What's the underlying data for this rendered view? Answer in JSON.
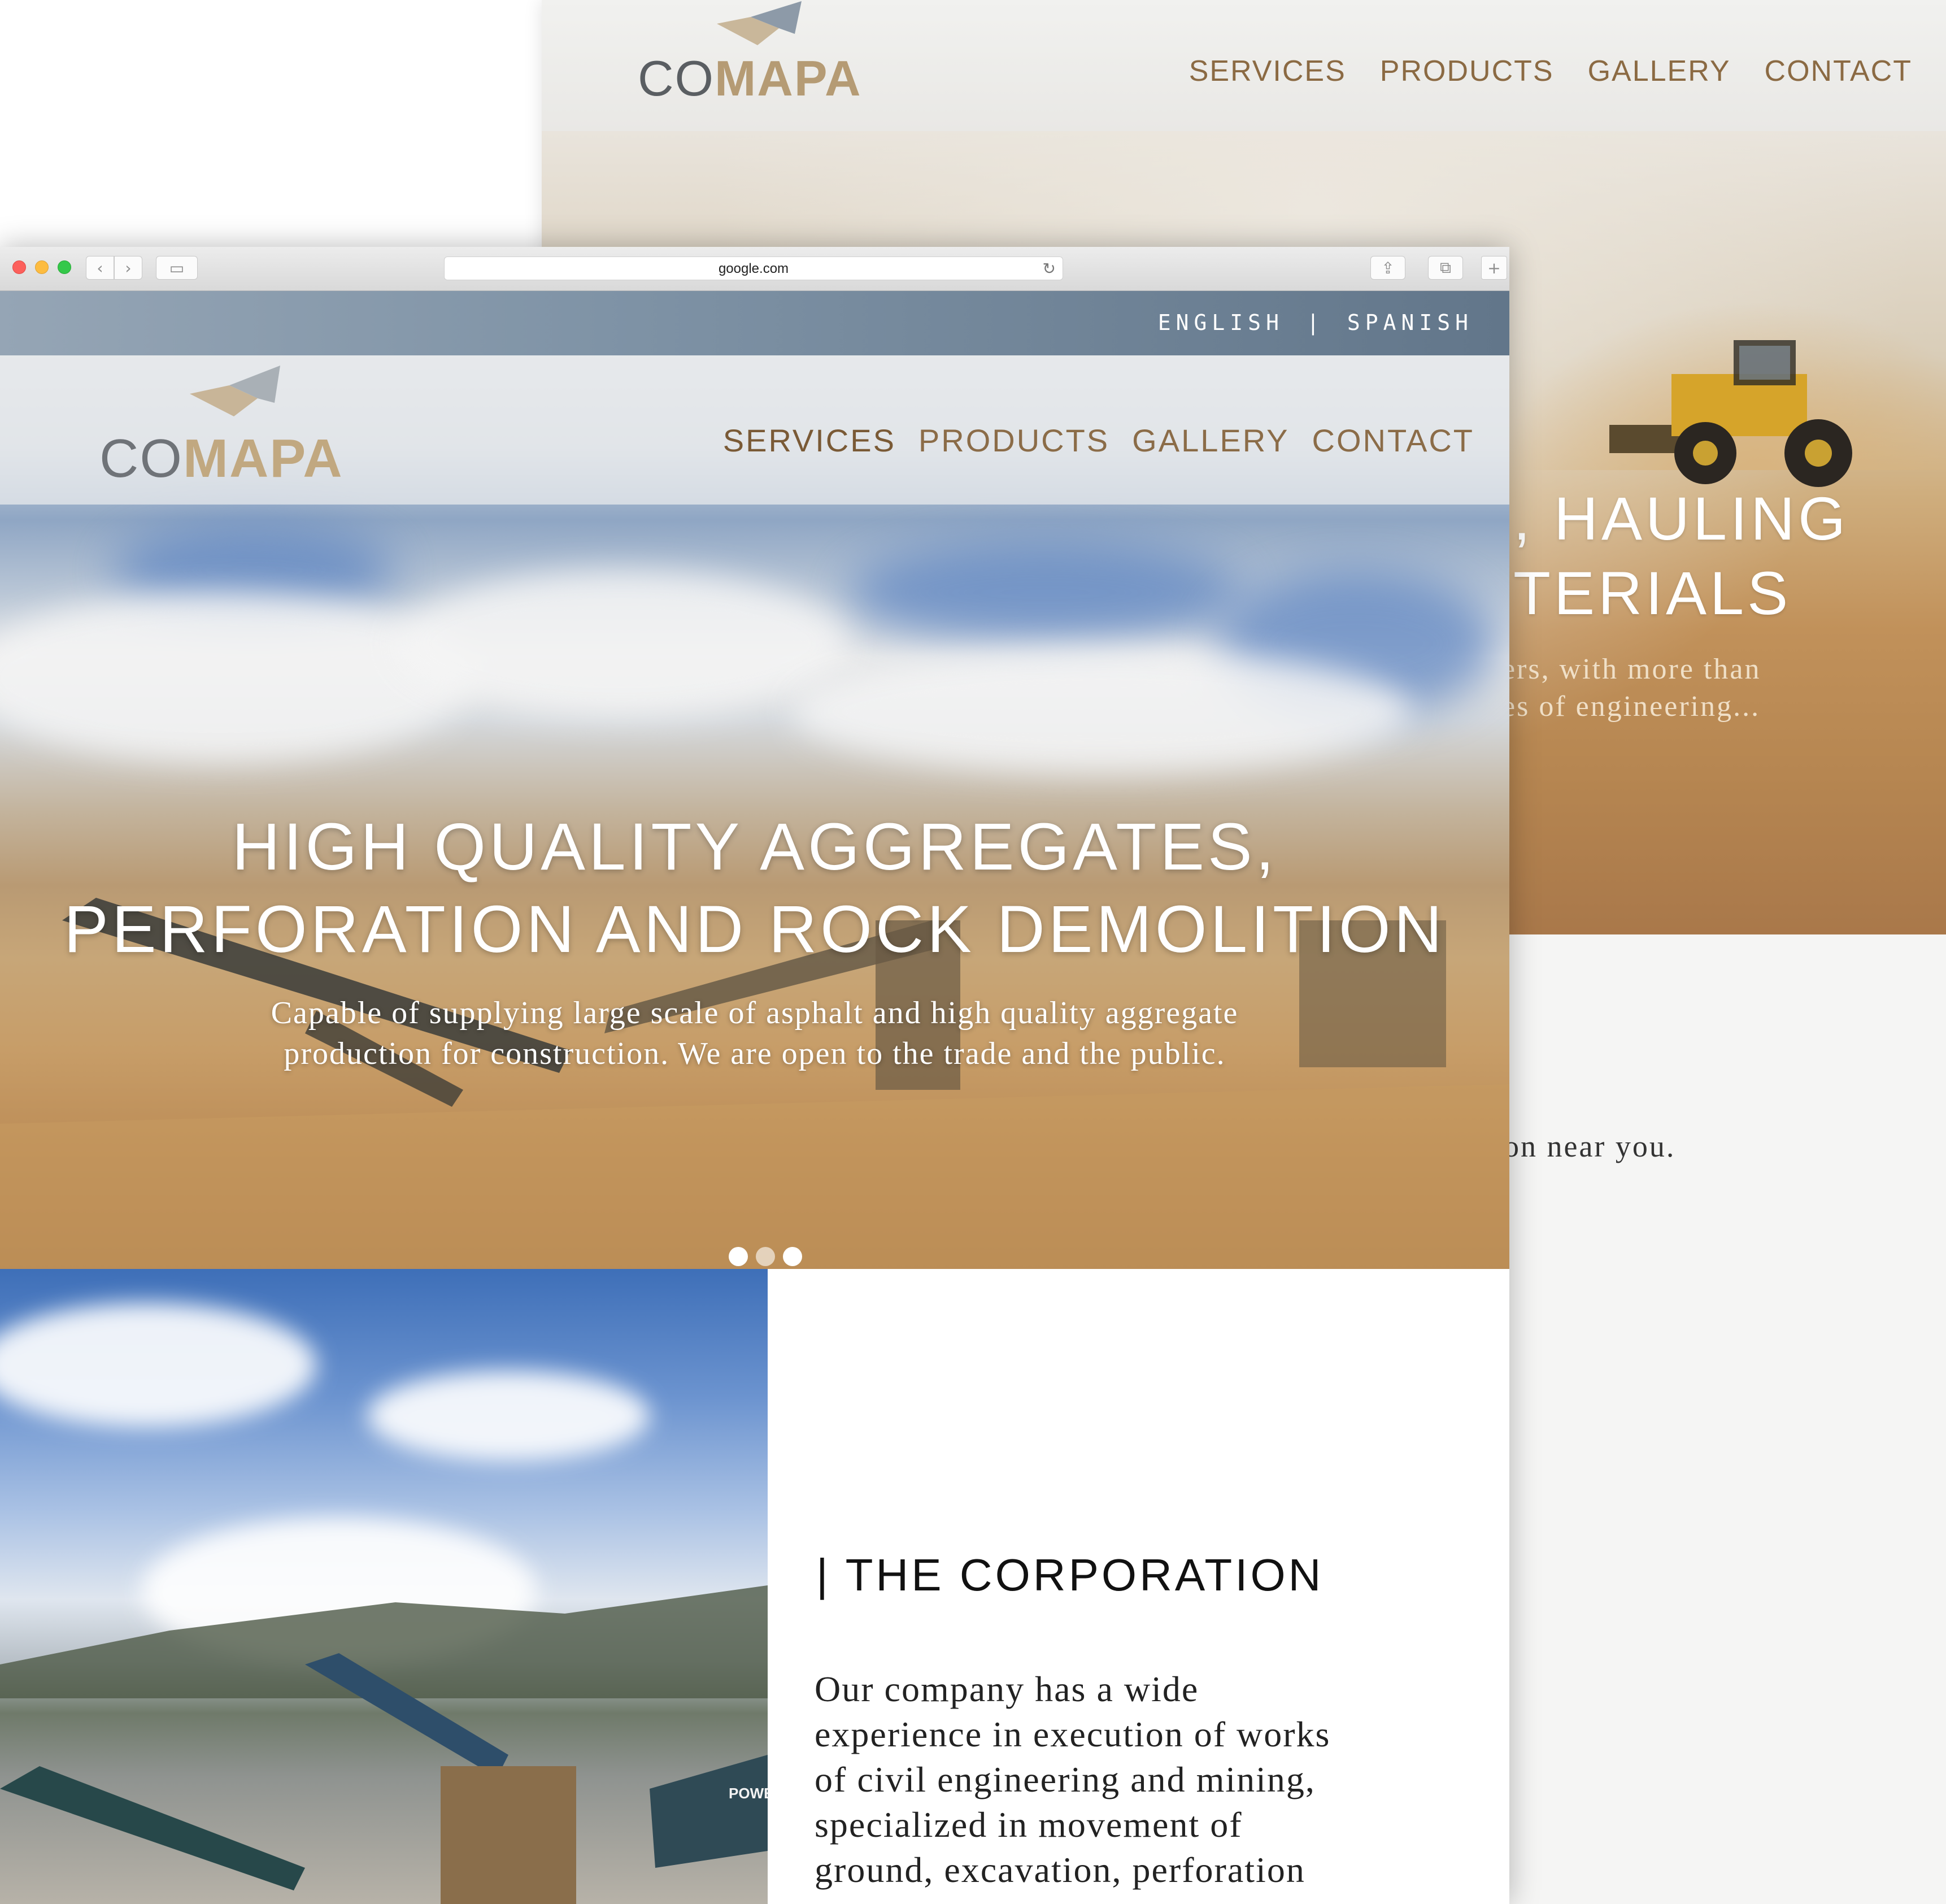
{
  "back_page": {
    "logo": {
      "part1": "CO",
      "part2": "MAPA"
    },
    "nav": [
      "SERVICES",
      "PRODUCTS",
      "GALLERY",
      "CONTACT"
    ],
    "hero_title": ", HAULING\nTERIALS",
    "hero_subtitle": "ers, with more than\nes of engineering...",
    "section_text": "ation near you."
  },
  "browser": {
    "address": "google.com"
  },
  "language": {
    "english": "ENGLISH",
    "separator": "|",
    "spanish": "SPANISH"
  },
  "logo": {
    "part1": "CO",
    "part2": "MAPA"
  },
  "nav": {
    "services": "SERVICES",
    "products": "PRODUCTS",
    "gallery": "GALLERY",
    "contact": "CONTACT"
  },
  "hero": {
    "title_line1": "HIGH QUALITY AGGREGATES,",
    "title_line2": "PERFORATION AND ROCK DEMOLITION",
    "subtitle_line1": "Capable of supplying large scale of asphalt and high quality aggregate",
    "subtitle_line2": "production for construction. We are open to the trade and the public.",
    "slide_count": 3,
    "active_slide": 1
  },
  "corporation": {
    "title": "| THE CORPORATION",
    "text_lines": [
      "Our company has a wide",
      "experience in execution of works",
      "of civil engineering and mining,",
      "specialized in movement of",
      "ground, excavation, perforation"
    ]
  },
  "image_text": {
    "power": "POWER"
  },
  "colors": {
    "nav_brown": "#8b6c48",
    "logo_gray": "#6f7378",
    "logo_tan": "#c1a880",
    "lang_bar": "#62768a"
  }
}
